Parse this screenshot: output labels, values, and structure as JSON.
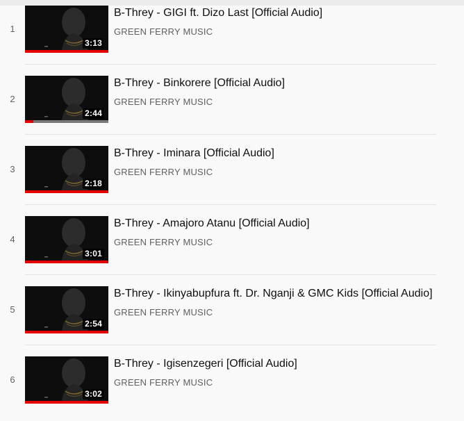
{
  "playlist": {
    "items": [
      {
        "index": "1",
        "title": "B-Threy - GIGI ft. Dizo Last [Official Audio]",
        "channel": "GREEN FERRY MUSIC",
        "duration": "3:13",
        "watched": 1.0
      },
      {
        "index": "2",
        "title": "B-Threy - Binkorere [Official Audio]",
        "channel": "GREEN FERRY MUSIC",
        "duration": "2:44",
        "watched": 0.1
      },
      {
        "index": "3",
        "title": "B-Threy - Iminara [Official Audio]",
        "channel": "GREEN FERRY MUSIC",
        "duration": "2:18",
        "watched": 1.0
      },
      {
        "index": "4",
        "title": "B-Threy - Amajoro Atanu [Official Audio]",
        "channel": "GREEN FERRY MUSIC",
        "duration": "3:01",
        "watched": 1.0
      },
      {
        "index": "5",
        "title": "B-Threy - Ikinyabupfura ft. Dr. Nganji & GMC Kids [Official Audio]",
        "channel": "GREEN FERRY MUSIC",
        "duration": "2:54",
        "watched": 1.0
      },
      {
        "index": "6",
        "title": "B-Threy - Igisenzegeri [Official Audio]",
        "channel": "GREEN FERRY MUSIC",
        "duration": "3:02",
        "watched": 1.0
      }
    ]
  },
  "colors": {
    "progress": "#e60000",
    "title_text": "#0f0f0f",
    "meta_text": "#606060"
  }
}
